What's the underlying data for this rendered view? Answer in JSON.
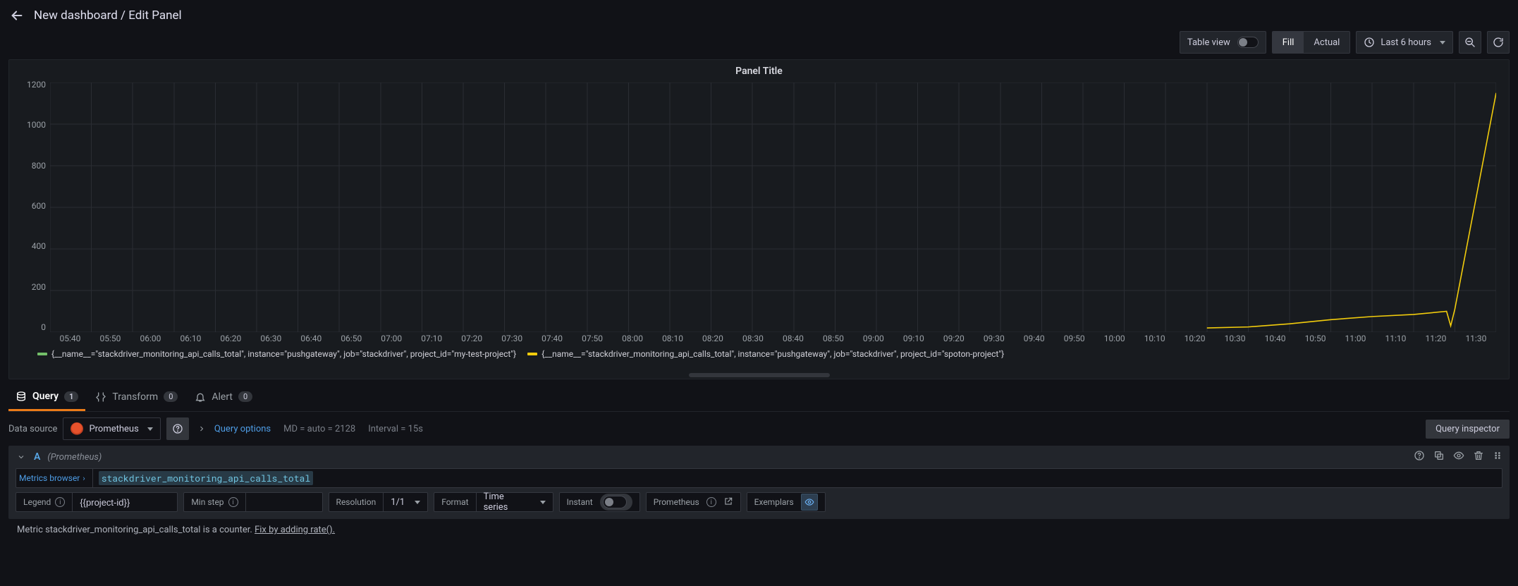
{
  "header": {
    "title": "New dashboard / Edit Panel"
  },
  "toolbar": {
    "table_view_label": "Table view",
    "fill_label": "Fill",
    "actual_label": "Actual",
    "time_range": "Last 6 hours"
  },
  "panel": {
    "title": "Panel Title"
  },
  "chart_data": {
    "type": "line",
    "xlabel": "",
    "ylabel": "",
    "ylim": [
      0,
      1200
    ],
    "y_ticks": [
      "1200",
      "1000",
      "800",
      "600",
      "400",
      "200",
      "0"
    ],
    "x_ticks": [
      "05:40",
      "05:50",
      "06:00",
      "06:10",
      "06:20",
      "06:30",
      "06:40",
      "06:50",
      "07:00",
      "07:10",
      "07:20",
      "07:30",
      "07:40",
      "07:50",
      "08:00",
      "08:10",
      "08:20",
      "08:30",
      "08:40",
      "08:50",
      "09:00",
      "09:10",
      "09:20",
      "09:30",
      "09:40",
      "09:50",
      "10:00",
      "10:10",
      "10:20",
      "10:30",
      "10:40",
      "10:50",
      "11:00",
      "11:10",
      "11:20",
      "11:30"
    ],
    "series": [
      {
        "name": "{__name__=\"stackdriver_monitoring_api_calls_total\", instance=\"pushgateway\", job=\"stackdriver\", project_id=\"my-test-project\"}",
        "color": "#73bf69",
        "points": []
      },
      {
        "name": "{__name__=\"stackdriver_monitoring_api_calls_total\", instance=\"pushgateway\", job=\"stackdriver\", project_id=\"spoton-project\"}",
        "color": "#f2cc0c",
        "points": [
          {
            "x": "10:20",
            "y": 20
          },
          {
            "x": "10:30",
            "y": 25
          },
          {
            "x": "10:40",
            "y": 40
          },
          {
            "x": "10:50",
            "y": 60
          },
          {
            "x": "11:00",
            "y": 75
          },
          {
            "x": "11:10",
            "y": 85
          },
          {
            "x": "11:18",
            "y": 100
          },
          {
            "x": "11:19",
            "y": 30
          },
          {
            "x": "11:20",
            "y": 110
          },
          {
            "x": "11:30",
            "y": 1150
          }
        ]
      }
    ]
  },
  "tabs": {
    "query": {
      "label": "Query",
      "count": "1"
    },
    "transform": {
      "label": "Transform",
      "count": "0"
    },
    "alert": {
      "label": "Alert",
      "count": "0"
    }
  },
  "query_bar": {
    "ds_label": "Data source",
    "ds_name": "Prometheus",
    "options_link": "Query options",
    "md_info": "MD = auto = 2128",
    "interval_info": "Interval = 15s",
    "inspector_label": "Query inspector"
  },
  "query_row": {
    "letter": "A",
    "subtype": "(Prometheus)",
    "metrics_browser_label": "Metrics browser",
    "expr_text": "stackdriver_monitoring_api_calls_total",
    "legend_label": "Legend",
    "legend_value": "{{project-id}}",
    "min_step_label": "Min step",
    "resolution_label": "Resolution",
    "resolution_value": "1/1",
    "format_label": "Format",
    "format_value": "Time series",
    "instant_label": "Instant",
    "prometheus_label": "Prometheus",
    "exemplars_label": "Exemplars"
  },
  "hint": {
    "text_prefix": "Metric stackdriver_monitoring_api_calls_total is a counter. ",
    "fix_text": "Fix by adding rate()."
  }
}
